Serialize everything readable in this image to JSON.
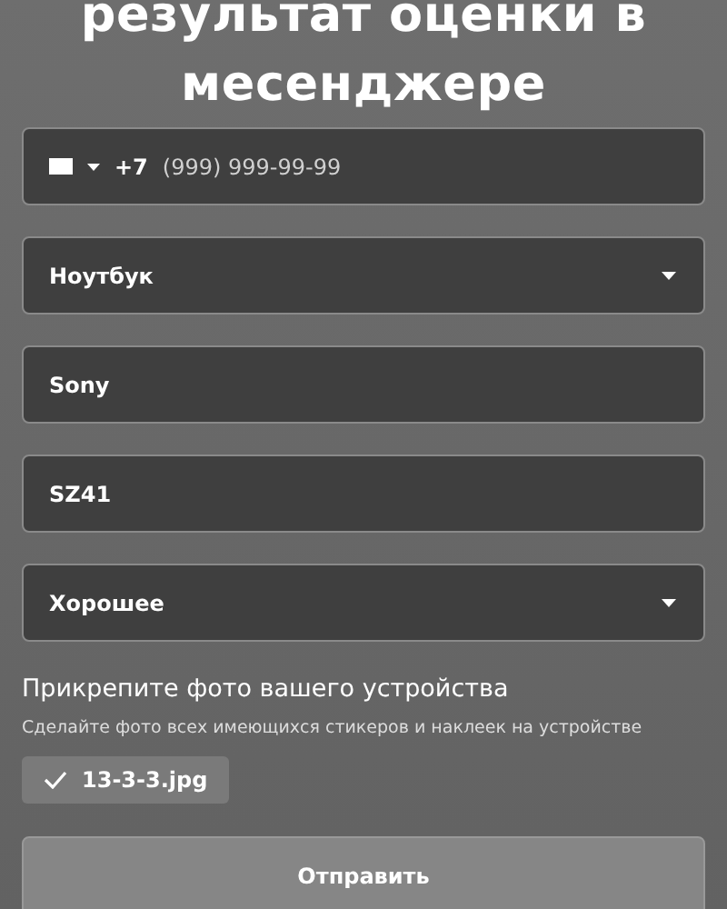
{
  "title_lines": [
    "результат оценки в",
    "месенджере"
  ],
  "fields": [
    {
      "kind": "phone",
      "prefix": "+7",
      "placeholder": "(999) 999-99-99"
    },
    {
      "kind": "select",
      "value": "Ноутбук"
    },
    {
      "kind": "text",
      "value": "Sony"
    },
    {
      "kind": "text",
      "value": "SZ41"
    },
    {
      "kind": "select",
      "value": "Хорошее"
    }
  ],
  "attach": {
    "label": "Прикрепите фото вашего устройства",
    "hint": "Сделайте фото всех имеющихся стикеров и наклеек на устройстве",
    "files": [
      "13-3-3.jpg"
    ]
  },
  "submit": "Отправить"
}
